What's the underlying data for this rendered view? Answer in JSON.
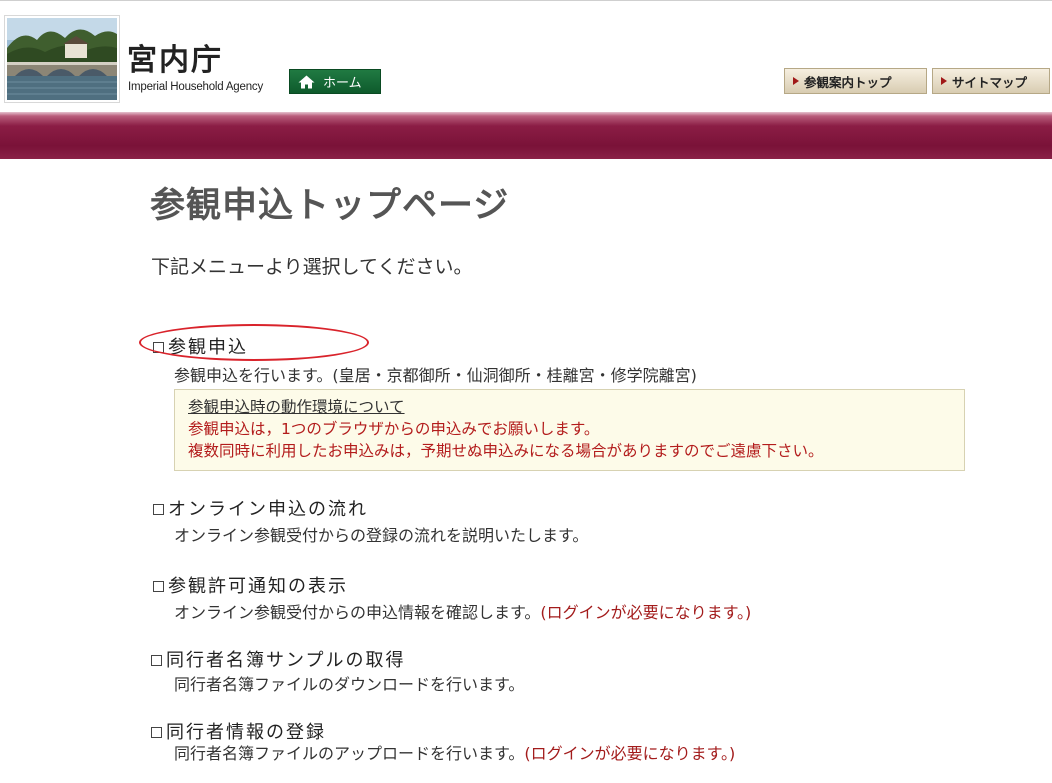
{
  "header": {
    "org_name": "宮内庁",
    "org_name_en": "Imperial Household Agency",
    "home_label": "ホーム",
    "nav": [
      {
        "label": "参観案内トップ"
      },
      {
        "label": "サイトマップ"
      }
    ]
  },
  "main": {
    "title": "参観申込トップページ",
    "subtitle": "下記メニューより選択してください。",
    "menu": [
      {
        "title": "参観申込",
        "desc": "参観申込を行います。(皇居・京都御所・仙洞御所・桂離宮・修学院離宮)",
        "note": ""
      },
      {
        "title": "オンライン申込の流れ",
        "desc": "オンライン参観受付からの登録の流れを説明いたします。",
        "note": ""
      },
      {
        "title": "参観許可通知の表示",
        "desc": "オンライン参観受付からの申込情報を確認します。",
        "note": "(ログインが必要になります。)"
      },
      {
        "title": "同行者名簿サンプルの取得",
        "desc": "同行者名簿ファイルのダウンロードを行います。",
        "note": ""
      },
      {
        "title": "同行者情報の登録",
        "desc": "同行者名簿ファイルのアップロードを行います。",
        "note": "(ログインが必要になります。)"
      }
    ],
    "notice": {
      "link": "参観申込時の動作環境について",
      "lines": [
        "参観申込は，1つのブラウザからの申込みでお願いします。",
        "複数同時に利用したお申込みは，予期せぬ申込みになる場合がありますのでご遠慮下さい。"
      ]
    }
  },
  "colors": {
    "banner": "#7a1238",
    "home_button": "#0e5a2c",
    "note_red": "#a31c1c",
    "highlight_ring": "#d9232b"
  }
}
